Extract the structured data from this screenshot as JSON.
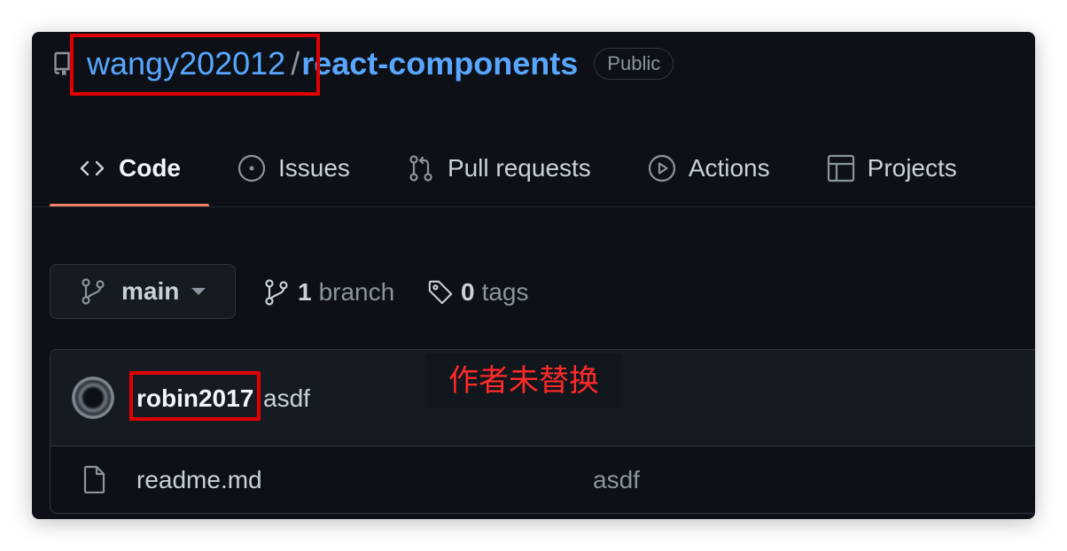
{
  "repo": {
    "owner": "wangy202012",
    "separator": "/",
    "name": "react-components",
    "visibility": "Public"
  },
  "tabs": [
    {
      "label": "Code",
      "icon": "code-icon",
      "selected": true
    },
    {
      "label": "Issues",
      "icon": "issue-opened-icon",
      "selected": false
    },
    {
      "label": "Pull requests",
      "icon": "git-pull-request-icon",
      "selected": false
    },
    {
      "label": "Actions",
      "icon": "play-icon",
      "selected": false
    },
    {
      "label": "Projects",
      "icon": "table-icon",
      "selected": false
    }
  ],
  "branch_select": {
    "current": "main"
  },
  "branches": {
    "count": "1",
    "label": "branch"
  },
  "tags": {
    "count": "0",
    "label": "tags"
  },
  "latest_commit": {
    "author": "robin2017",
    "message": "asdf"
  },
  "annotation": {
    "text": "作者未替换"
  },
  "files": [
    {
      "name": "readme.md",
      "commit_message": "asdf",
      "icon": "file-icon"
    }
  ],
  "colors": {
    "background": "#0d1117",
    "link": "#58a6ff",
    "tab_underline": "#f78166",
    "highlight": "#e00000",
    "annotation": "#ff2a2a"
  }
}
